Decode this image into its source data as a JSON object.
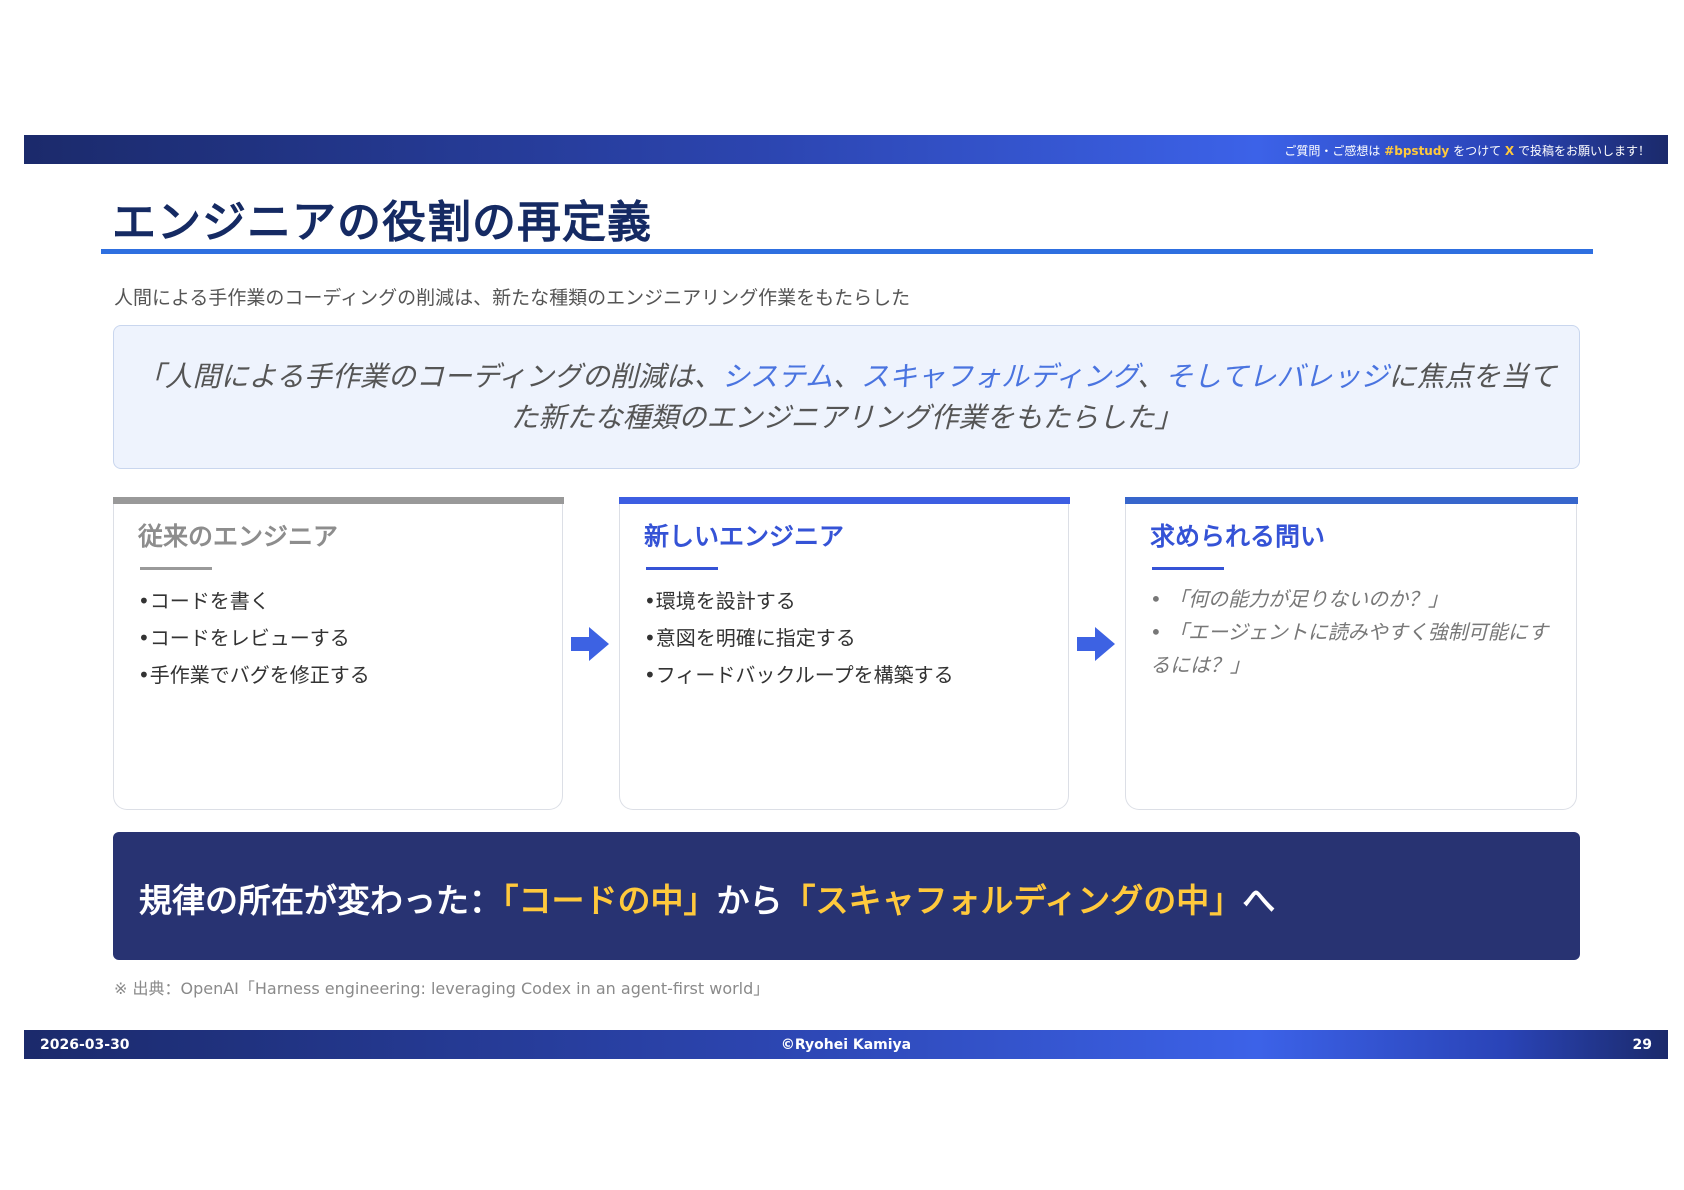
{
  "header": {
    "note_prefix": "ご質問・ご感想は ",
    "hashtag": "#bpstudy",
    "note_mid": " をつけて ",
    "x": "X",
    "note_suffix": " で投稿をお願いします！"
  },
  "title": "エンジニアの役割の再定義",
  "subtitle": "人間による手作業のコーディングの削減は、新たな種類のエンジニアリング作業をもたらした",
  "quote": {
    "part1": "「人間による手作業のコーディングの削減は、",
    "hl1": "システム",
    "sep1": "、",
    "hl2": "スキャフォルディング",
    "sep2": "、",
    "hl3": "そしてレバレッジ",
    "part2": "に焦点を当てた新たな種類のエンジニアリング作業をもたらした」"
  },
  "cards": [
    {
      "title": "従来のエンジニア",
      "items": [
        "•コードを書く",
        "•コードをレビューする",
        "•手作業でバグを修正する"
      ]
    },
    {
      "title": "新しいエンジニア",
      "items": [
        "•環境を設計する",
        "•意図を明確に指定する",
        "•フィードバックループを構築する"
      ]
    },
    {
      "title": "求められる問い",
      "items": [
        "• 「何の能力が足りないのか？」",
        "• 「エージェントに読みやすく強制可能にするには？」"
      ]
    }
  ],
  "banner": {
    "prefix": "規律の所在が変わった：",
    "from": "「コードの中」",
    "mid": "から",
    "to": "「スキャフォルディングの中」",
    "suffix": "へ"
  },
  "source": "※ 出典：OpenAI「Harness engineering: leveraging Codex in an agent-first world」",
  "footer": {
    "date": "2026-03-30",
    "copyright": "©Ryohei Kamiya",
    "page": "29"
  },
  "colors": {
    "title": "#152a63",
    "accent_blue": "#3553d6",
    "highlight_yellow": "#ffc93c",
    "banner_bg": "#283372"
  }
}
